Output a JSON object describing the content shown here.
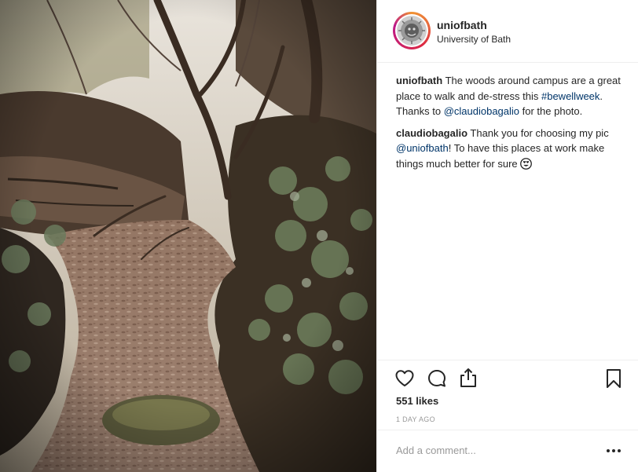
{
  "post": {
    "username": "uniofbath",
    "location": "University of Bath",
    "comments": [
      {
        "user": "uniofbath",
        "text_1": " The woods around campus are a great place to walk and de-stress this ",
        "hashtag": "#bewellweek",
        "text_2": ". Thanks to ",
        "mention": "@claudiobagalio",
        "text_3": " for the photo."
      },
      {
        "user": "claudiobagalio",
        "text_1": " Thank you for choosing my pic ",
        "mention": "@uniofbath",
        "text_2": "! To have this places at work make things much better for sure "
      }
    ],
    "likes": "551 likes",
    "time": "1 DAY AGO",
    "comment_placeholder": "Add a comment...",
    "icons": {
      "like": "heart-icon",
      "comment": "comment-bubble-icon",
      "share": "share-icon",
      "save": "bookmark-icon",
      "more": "more-dots-icon",
      "emoji": "heart-eyes-emoji-icon"
    },
    "colors": {
      "text": "#262626",
      "link": "#003569",
      "muted": "#999999",
      "divider": "#efefef"
    }
  }
}
